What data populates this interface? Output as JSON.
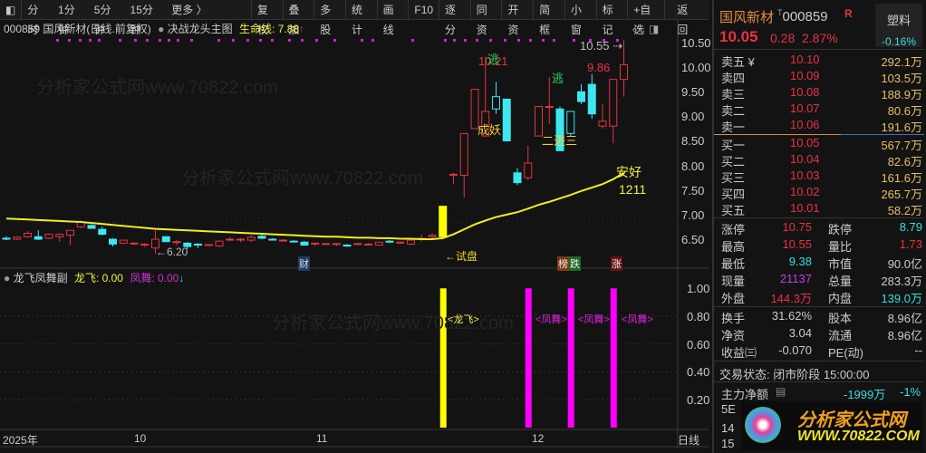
{
  "toolbar": {
    "items": [
      "分时",
      "1分钟",
      "5分钟",
      "15分钟",
      "更多 〉"
    ],
    "buttons": [
      "复权",
      "叠加",
      "多股",
      "统计",
      "画线",
      "F10",
      "逐分",
      "同资",
      "开资",
      "简框",
      "小窗",
      "标记",
      "+自选",
      "返回"
    ]
  },
  "info": {
    "code_name": "000859 国风新材(日线.前复权)",
    "indicator": "决战龙头主图",
    "lifeline_label": "生命线: 7.88",
    "arrow": "↑"
  },
  "sub": {
    "name": "龙飞凤舞副",
    "longfei": "龙飞: 0.00",
    "fengwu": "凤舞: 0.00",
    "arrow": "↓",
    "bar_label_long": "<龙飞>",
    "bar_label_feng": "<凤舞>",
    "axis": [
      "1.00",
      "0.80",
      "0.60",
      "0.40",
      "0.20"
    ]
  },
  "price_axis": [
    "10.50",
    "10.00",
    "9.50",
    "9.00",
    "8.50",
    "8.00",
    "7.50",
    "7.00",
    "6.50"
  ],
  "date_axis": {
    "year": "2025年",
    "m10": "10",
    "m11": "11",
    "m12": "12",
    "period": "日线"
  },
  "annotations": {
    "high1": "10.21",
    "high2": "9.86",
    "high3": "10.55",
    "low": "←6.20",
    "escape": "逃",
    "chengyao": "成妖",
    "erjinsan": "二进三",
    "anhao": "安好",
    "num": "1211",
    "shipan": "←试盘",
    "cai": "财",
    "bang": "榜",
    "die": "跌",
    "zhang": "涨"
  },
  "watermark": "分析家公式网www.70822.com",
  "chart_data": {
    "type": "candlestick",
    "candles": [
      [
        6.52,
        6.56,
        6.48,
        6.5
      ],
      [
        6.5,
        6.56,
        6.48,
        6.54
      ],
      [
        6.55,
        6.66,
        6.53,
        6.62
      ],
      [
        6.55,
        6.68,
        6.48,
        6.5
      ],
      [
        6.52,
        6.62,
        6.5,
        6.6
      ],
      [
        6.55,
        6.62,
        6.45,
        6.6
      ],
      [
        6.58,
        6.66,
        6.38,
        6.68
      ],
      [
        6.75,
        6.88,
        6.72,
        6.85
      ],
      [
        6.78,
        6.8,
        6.72,
        6.72
      ],
      [
        6.7,
        6.76,
        6.58,
        6.6
      ],
      [
        6.5,
        6.52,
        6.35,
        6.4
      ],
      [
        6.42,
        6.48,
        6.4,
        6.48
      ],
      [
        6.42,
        6.44,
        6.38,
        6.42
      ],
      [
        6.38,
        6.42,
        6.34,
        6.4
      ],
      [
        6.32,
        6.68,
        6.2,
        6.5
      ],
      [
        6.55,
        6.56,
        6.48,
        6.45
      ],
      [
        6.45,
        6.48,
        6.38,
        6.45
      ],
      [
        6.42,
        6.44,
        6.3,
        6.35
      ],
      [
        6.4,
        6.42,
        6.32,
        6.38
      ],
      [
        6.38,
        6.4,
        6.36,
        6.39
      ],
      [
        6.36,
        6.48,
        6.34,
        6.46
      ],
      [
        6.5,
        6.54,
        6.46,
        6.5
      ],
      [
        6.5,
        6.52,
        6.44,
        6.5
      ],
      [
        6.48,
        6.58,
        6.44,
        6.54
      ],
      [
        6.56,
        6.62,
        6.5,
        6.52
      ],
      [
        6.5,
        6.52,
        6.48,
        6.49
      ],
      [
        6.48,
        6.5,
        6.46,
        6.48
      ],
      [
        6.46,
        6.48,
        6.44,
        6.45
      ],
      [
        6.44,
        6.46,
        6.38,
        6.38
      ],
      [
        6.4,
        6.42,
        6.36,
        6.42
      ],
      [
        6.4,
        6.42,
        6.38,
        6.41
      ],
      [
        6.4,
        6.42,
        6.36,
        6.41
      ],
      [
        6.38,
        6.4,
        6.34,
        6.36
      ],
      [
        6.4,
        6.42,
        6.38,
        6.41
      ],
      [
        6.4,
        6.42,
        6.38,
        6.4
      ],
      [
        6.38,
        6.44,
        6.38,
        6.44
      ],
      [
        6.46,
        6.48,
        6.42,
        6.44
      ],
      [
        6.42,
        6.45,
        6.4,
        6.44
      ],
      [
        6.4,
        6.5,
        6.38,
        6.48
      ],
      [
        6.52,
        6.6,
        6.46,
        6.52
      ],
      [
        6.55,
        6.62,
        6.52,
        6.58
      ],
      [
        6.55,
        7.17,
        6.55,
        7.17
      ],
      [
        7.82,
        7.85,
        7.62,
        7.82
      ],
      [
        7.8,
        8.65,
        7.35,
        8.65
      ],
      [
        8.75,
        9.55,
        8.75,
        9.55
      ],
      [
        8.6,
        10.21,
        8.6,
        9.1
      ],
      [
        9.15,
        9.7,
        9.05,
        9.4
      ],
      [
        9.35,
        9.35,
        8.5,
        8.5
      ],
      [
        7.85,
        7.95,
        7.6,
        7.65
      ],
      [
        7.75,
        8.4,
        7.7,
        8.05
      ],
      [
        8.6,
        9.2,
        8.6,
        9.2
      ],
      [
        9.2,
        9.8,
        8.85,
        9.2
      ],
      [
        9.15,
        9.2,
        8.3,
        8.3
      ],
      [
        8.65,
        9.1,
        8.6,
        9.1
      ],
      [
        9.5,
        9.65,
        9.25,
        9.3
      ],
      [
        9.65,
        9.86,
        8.95,
        9.05
      ],
      [
        8.8,
        9.25,
        8.75,
        8.9
      ],
      [
        8.8,
        9.75,
        8.45,
        9.75
      ],
      [
        9.75,
        10.55,
        9.4,
        10.05
      ]
    ],
    "yellow_index": 41,
    "filled_red_index": 48,
    "ma": [
      6.92,
      6.91,
      6.9,
      6.89,
      6.88,
      6.87,
      6.86,
      6.85,
      6.83,
      6.81,
      6.79,
      6.77,
      6.75,
      6.73,
      6.71,
      6.7,
      6.69,
      6.68,
      6.67,
      6.66,
      6.65,
      6.64,
      6.63,
      6.62,
      6.61,
      6.6,
      6.59,
      6.58,
      6.57,
      6.56,
      6.55,
      6.55,
      6.54,
      6.53,
      6.53,
      6.52,
      6.52,
      6.51,
      6.51,
      6.5,
      6.5,
      6.52,
      6.6,
      6.7,
      6.8,
      6.88,
      6.95,
      7.0,
      7.05,
      7.12,
      7.2,
      7.26,
      7.33,
      7.4,
      7.48,
      7.55,
      7.62,
      7.72,
      7.85
    ],
    "ylim": [
      6.2,
      10.6
    ],
    "signals": [
      {
        "index": 41,
        "type": "longfei",
        "value": 1
      },
      {
        "index": 49,
        "type": "fengwu",
        "value": 1
      },
      {
        "index": 53,
        "type": "fengwu",
        "value": 1
      },
      {
        "index": 57,
        "type": "fengwu",
        "value": 1
      }
    ]
  },
  "quote": {
    "name": "国风新材",
    "code": "000859",
    "flag": "R",
    "price": "10.05",
    "change": "0.28",
    "pct": "2.87%",
    "sector": "塑料",
    "sector_pct": "-0.16%",
    "asks": [
      {
        "l": "卖五 ¥",
        "p": "10.10",
        "v": "292.1万"
      },
      {
        "l": "卖四",
        "p": "10.09",
        "v": "103.5万"
      },
      {
        "l": "卖三",
        "p": "10.08",
        "v": "188.9万"
      },
      {
        "l": "卖二",
        "p": "10.07",
        "v": "80.6万"
      },
      {
        "l": "卖一",
        "p": "10.06",
        "v": "191.6万"
      }
    ],
    "bids": [
      {
        "l": "买一",
        "p": "10.05",
        "v": "567.7万"
      },
      {
        "l": "买二",
        "p": "10.04",
        "v": "82.6万"
      },
      {
        "l": "买三",
        "p": "10.03",
        "v": "161.6万"
      },
      {
        "l": "买四",
        "p": "10.02",
        "v": "265.7万"
      },
      {
        "l": "买五",
        "p": "10.01",
        "v": "58.2万"
      }
    ],
    "stats": [
      [
        "涨停",
        "10.75",
        "跌停",
        "8.79"
      ],
      [
        "最高",
        "10.55",
        "量比",
        "1.73"
      ],
      [
        "最低",
        "9.38",
        "市值",
        "90.0亿"
      ],
      [
        "现量",
        "21137",
        "总量",
        "283.3万"
      ],
      [
        "外盘",
        "144.3万",
        "内盘",
        "139.0万"
      ]
    ],
    "stats2": [
      [
        "换手",
        "31.62%",
        "股本",
        "8.96亿"
      ],
      [
        "净资",
        "3.04",
        "流通",
        "8.96亿"
      ],
      [
        "收益㈢",
        "-0.070",
        "PE(动)",
        "--"
      ]
    ],
    "status": "交易状态: 闭市阶段 15:00:00",
    "main_flow_label": "主力净额",
    "main_flow": "-1999万",
    "main_flow_pct": "-1%",
    "row5": "5E",
    "row14": "14",
    "row15": "15"
  },
  "logo": {
    "title": "分析家公式网",
    "url": "WWW.70822.COM"
  }
}
